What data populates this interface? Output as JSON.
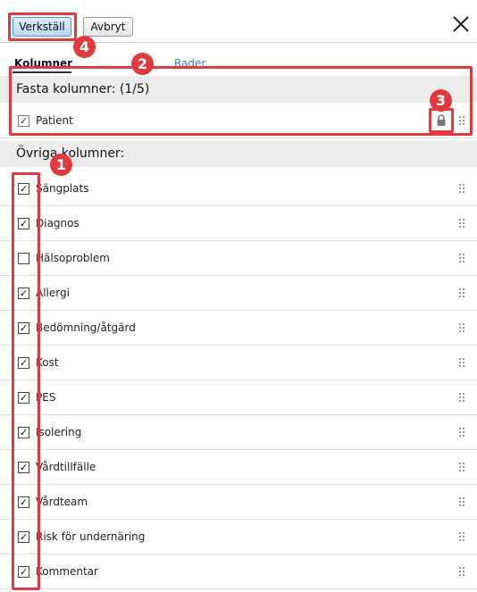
{
  "toolbar": {
    "apply_label": "Verkställ",
    "cancel_label": "Avbryt"
  },
  "tabs": {
    "columns_label": "Kolumner",
    "rows_label": "Rader"
  },
  "fixed": {
    "heading": "Fasta kolumner: (1/5)",
    "items": [
      {
        "label": "Patient",
        "checked": true,
        "locked": true
      }
    ]
  },
  "other": {
    "heading": "Övriga kolumner:",
    "items": [
      {
        "label": "Sängplats",
        "checked": true
      },
      {
        "label": "Diagnos",
        "checked": true
      },
      {
        "label": "Hälsoproblem",
        "checked": false
      },
      {
        "label": "Allergi",
        "checked": true
      },
      {
        "label": "Bedömning/åtgärd",
        "checked": true
      },
      {
        "label": "Kost",
        "checked": true
      },
      {
        "label": "PES",
        "checked": true
      },
      {
        "label": "Isolering",
        "checked": true
      },
      {
        "label": "Vårdtillfälle",
        "checked": true
      },
      {
        "label": "Vårdteam",
        "checked": true
      },
      {
        "label": "Risk för undernäring",
        "checked": true
      },
      {
        "label": "Kommentar",
        "checked": true
      }
    ]
  },
  "badges": [
    "1",
    "2",
    "3",
    "4"
  ],
  "colors": {
    "highlight": "#e0393e",
    "link": "#3a7fc0",
    "section_bg": "#ececec"
  }
}
